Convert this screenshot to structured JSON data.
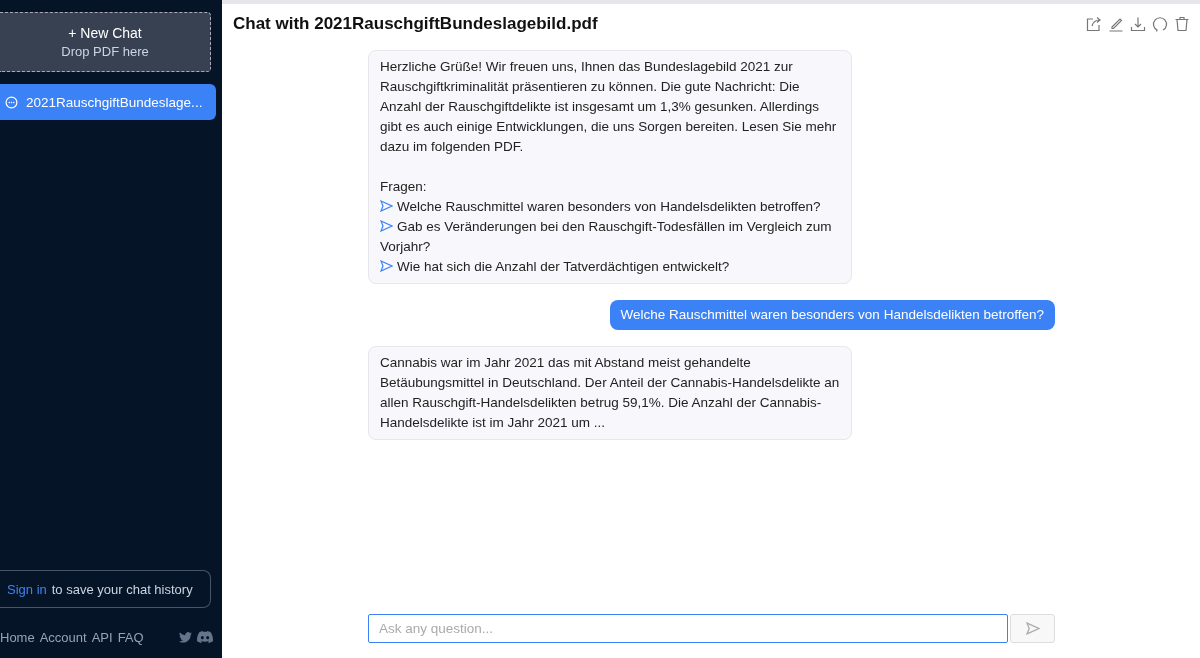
{
  "sidebar": {
    "new_chat": {
      "label": "+ New Chat",
      "hint": "Drop PDF here"
    },
    "chats": [
      {
        "title": "2021RauschgiftBundeslage...",
        "selected": true
      }
    ],
    "sign_in": {
      "link": "Sign in",
      "text": "to save your chat history"
    },
    "footer_links": [
      "Home",
      "Account",
      "API",
      "FAQ"
    ]
  },
  "header": {
    "title": "Chat with 2021RauschgiftBundeslagebild.pdf"
  },
  "messages": [
    {
      "kind": "bot",
      "text": "Herzliche Grüße! Wir freuen uns, Ihnen das Bundeslagebild 2021 zur Rauschgiftkriminalität präsentieren zu können. Die gute Nachricht: Die Anzahl der Rauschgiftdelikte ist insgesamt um 1,3% gesunken. Allerdings gibt es auch einige Entwicklungen, die uns Sorgen bereiten. Lesen Sie mehr dazu im folgenden PDF.",
      "questions_heading": "Fragen:",
      "questions": [
        "Welche Rauschmittel waren besonders von Handelsdelikten betroffen?",
        "Gab es Veränderungen bei den Rauschgift-Todesfällen im Vergleich zum Vorjahr?",
        "Wie hat sich die Anzahl der Tatverdächtigen entwickelt?"
      ]
    },
    {
      "kind": "user",
      "text": "Welche Rauschmittel waren besonders von Handelsdelikten betroffen?"
    },
    {
      "kind": "bot",
      "text": "Cannabis war im Jahr 2021 das mit Abstand meist gehandelte Betäubungsmittel in Deutschland. Der Anteil der Cannabis-Handelsdelikte an allen Rauschgift-Handelsdelikten betrug 59,1%. Die Anzahl der Cannabis-Handelsdelikte ist im Jahr 2021 um ..."
    }
  ],
  "input": {
    "placeholder": "Ask any question..."
  }
}
